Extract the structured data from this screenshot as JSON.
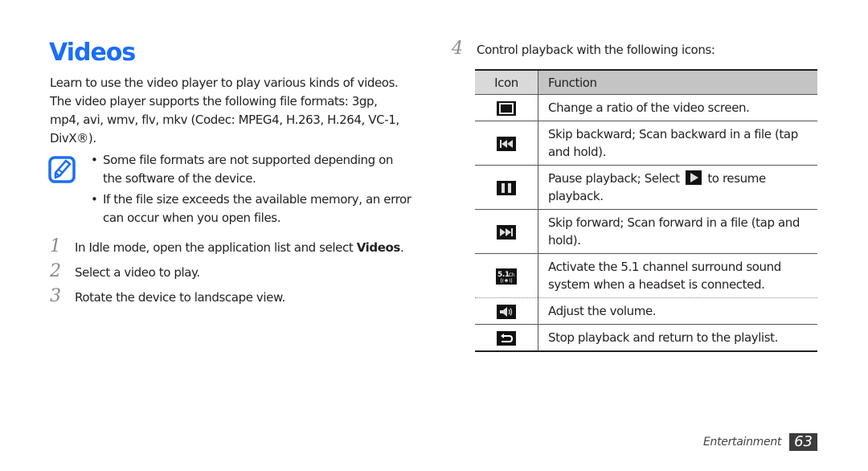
{
  "section": {
    "title": "Videos",
    "intro": "Learn to use the video player to play various kinds of videos. The video player supports the following file formats: 3gp, mp4, avi, wmv, flv, mkv (Codec: MPEG4, H.263, H.264, VC-1, DivX®).",
    "note_icon": "note-pencil-icon",
    "notes": [
      "Some file formats are not supported depending on the software of the device.",
      "If the file size exceeds the available memory, an error can occur when you open files."
    ]
  },
  "steps": [
    {
      "num": "1",
      "text_before": "In Idle mode, open the application list and select ",
      "bold": "Videos",
      "text_after": "."
    },
    {
      "num": "2",
      "text": "Select a video to play."
    },
    {
      "num": "3",
      "text": "Rotate the device to landscape view."
    },
    {
      "num": "4",
      "text": "Control playback with the following icons:"
    }
  ],
  "table": {
    "headers": {
      "icon": "Icon",
      "function": "Function"
    },
    "rows": [
      {
        "icon": "aspect-ratio-icon",
        "function": "Change a ratio of the video screen."
      },
      {
        "icon": "skip-backward-icon",
        "function": "Skip backward; Scan backward in a file (tap and hold)."
      },
      {
        "icon": "pause-icon",
        "function_before": "Pause playback; Select ",
        "inline_icon": "play-icon",
        "function_after": " to resume playback."
      },
      {
        "icon": "skip-forward-icon",
        "function": "Skip forward; Scan forward in a file (tap and hold)."
      },
      {
        "icon": "surround-5-1-icon",
        "icon_text": "5.1",
        "icon_sub": "Ch",
        "function": "Activate the 5.1 channel surround sound system when a headset is connected."
      },
      {
        "icon": "volume-icon",
        "function": "Adjust the volume."
      },
      {
        "icon": "return-icon",
        "function": "Stop playback and return to the playlist."
      }
    ]
  },
  "footer": {
    "section_name": "Entertainment",
    "page_number": "63"
  },
  "colors": {
    "title": "#1a6ef5",
    "text": "#231f20",
    "header_icon_bg": "#d9d9d9",
    "header_function_bg": "#c4c4c4",
    "page_number_bg": "#3c3c3c"
  }
}
